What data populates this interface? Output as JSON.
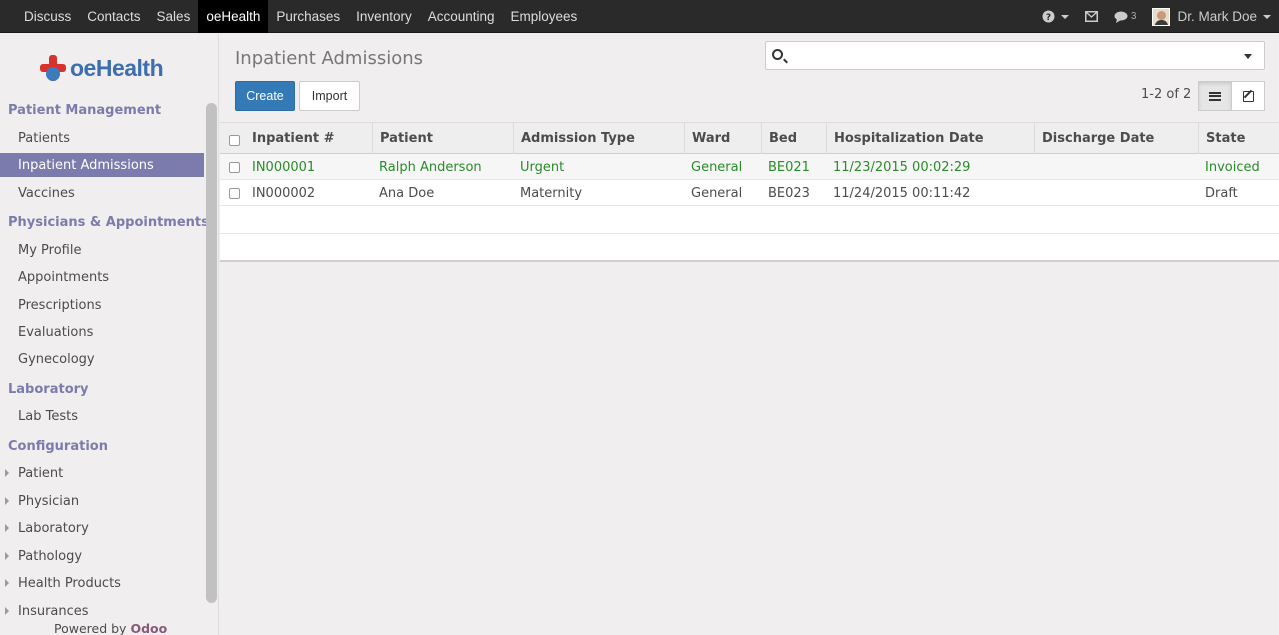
{
  "topbar": {
    "menu": [
      {
        "label": "Discuss",
        "active": false
      },
      {
        "label": "Contacts",
        "active": false
      },
      {
        "label": "Sales",
        "active": false
      },
      {
        "label": "oeHealth",
        "active": true
      },
      {
        "label": "Purchases",
        "active": false
      },
      {
        "label": "Inventory",
        "active": false
      },
      {
        "label": "Accounting",
        "active": false
      },
      {
        "label": "Employees",
        "active": false
      }
    ],
    "help_icon": "question-circle-icon",
    "mail_icon": "envelope-icon",
    "chat_icon": "chat-bubble-icon",
    "chat_count": "3",
    "user_name": "Dr. Mark Doe"
  },
  "sidebar": {
    "logo_text": "oeHealth",
    "sections": [
      {
        "title": "Patient Management",
        "items": [
          {
            "label": "Patients",
            "active": false
          },
          {
            "label": "Inpatient Admissions",
            "active": true
          },
          {
            "label": "Vaccines",
            "active": false
          }
        ]
      },
      {
        "title": "Physicians & Appointments",
        "items": [
          {
            "label": "My Profile"
          },
          {
            "label": "Appointments"
          },
          {
            "label": "Prescriptions"
          },
          {
            "label": "Evaluations"
          },
          {
            "label": "Gynecology"
          }
        ]
      },
      {
        "title": "Laboratory",
        "items": [
          {
            "label": "Lab Tests"
          }
        ]
      },
      {
        "title": "Configuration",
        "items": [
          {
            "label": "Patient"
          },
          {
            "label": "Physician"
          },
          {
            "label": "Laboratory"
          },
          {
            "label": "Pathology"
          },
          {
            "label": "Health Products"
          },
          {
            "label": "Insurances"
          }
        ]
      }
    ],
    "powered_prefix": "Powered by",
    "powered_brand": "Odoo"
  },
  "main": {
    "title": "Inpatient Admissions",
    "search_placeholder": "",
    "create_label": "Create",
    "import_label": "Import",
    "pager": "1-2 of 2",
    "columns": [
      "Inpatient #",
      "Patient",
      "Admission Type",
      "Ward",
      "Bed",
      "Hospitalization Date",
      "Discharge Date",
      "State"
    ],
    "rows": [
      {
        "inpatient": "IN000001",
        "patient": "Ralph Anderson",
        "admission_type": "Urgent",
        "ward": "General",
        "bed": "BE021",
        "hospitalization_date": "11/23/2015 00:02:29",
        "discharge_date": "",
        "state": "Invoiced"
      },
      {
        "inpatient": "IN000002",
        "patient": "Ana Doe",
        "admission_type": "Maternity",
        "ward": "General",
        "bed": "BE023",
        "hospitalization_date": "11/24/2015 00:11:42",
        "discharge_date": "",
        "state": "Draft"
      }
    ]
  },
  "colors": {
    "topbar_bg": "#2a2a2a",
    "sidebar_active": "#7c7bad",
    "primary_button": "#337ab7",
    "invoiced_row_text": "#2a8b2a",
    "brand_odoo": "#875a7b"
  }
}
